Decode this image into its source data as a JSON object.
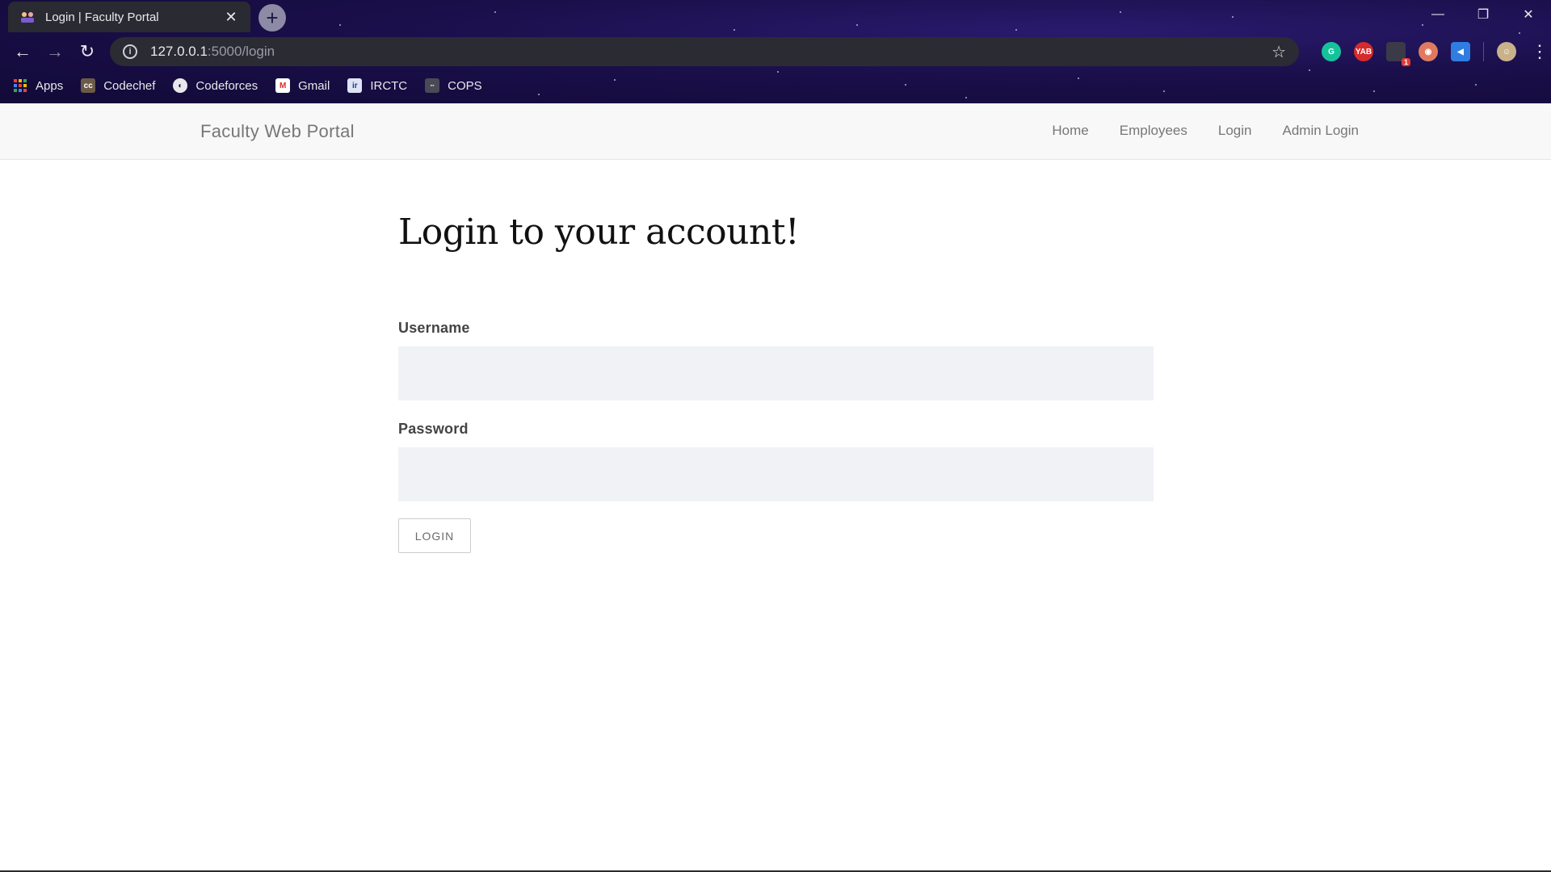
{
  "browser": {
    "tab_title": "Login | Faculty Portal",
    "url_host": "127.0.0.1",
    "url_rest": ":5000/login",
    "bookmarks": [
      {
        "label": "Apps",
        "icon": "apps-grid-icon"
      },
      {
        "label": "Codechef",
        "icon": "codechef-icon"
      },
      {
        "label": "Codeforces",
        "icon": "globe-icon"
      },
      {
        "label": "Gmail",
        "icon": "gmail-icon"
      },
      {
        "label": "IRCTC",
        "icon": "irctc-icon"
      },
      {
        "label": "COPS",
        "icon": "cops-icon"
      }
    ],
    "extension_badge": "1"
  },
  "navbar": {
    "brand": "Faculty Web Portal",
    "links": [
      "Home",
      "Employees",
      "Login",
      "Admin Login"
    ]
  },
  "form": {
    "heading": "Login to your account!",
    "username_label": "Username",
    "username_value": "",
    "password_label": "Password",
    "password_value": "",
    "submit_label": "LOGIN"
  },
  "colors": {
    "chrome_bg": "#1a0f4a",
    "navbar_bg": "#f8f8f8",
    "input_bg": "#f1f2f6",
    "link_color": "#777777"
  }
}
